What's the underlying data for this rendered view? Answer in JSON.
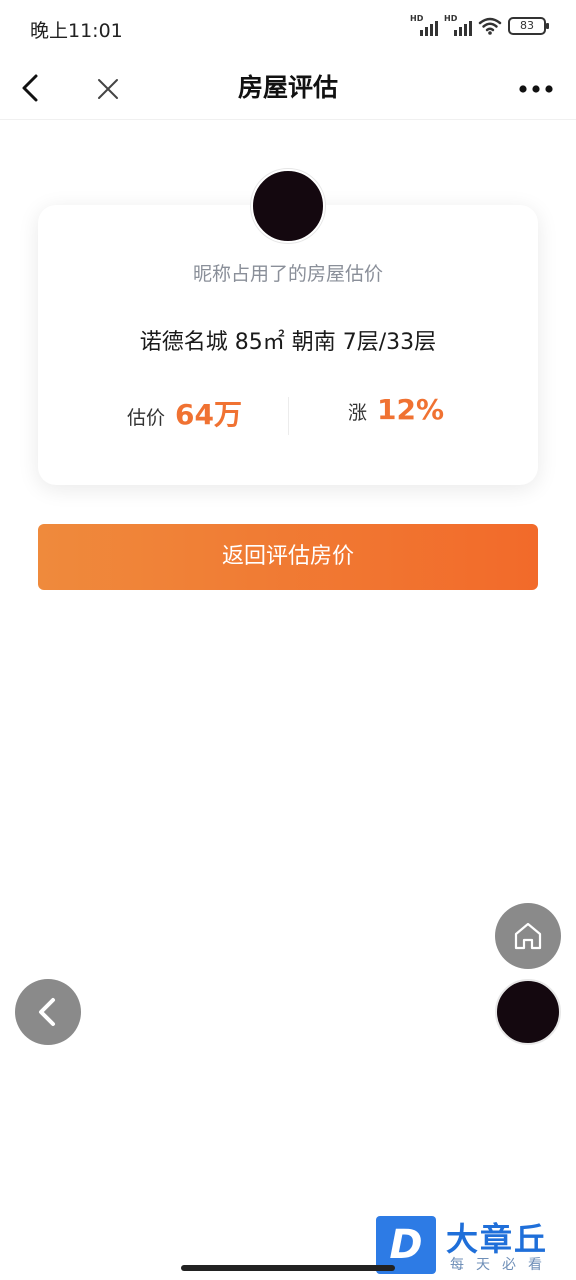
{
  "status_bar": {
    "time": "晚上11:01",
    "signal_1_label": "HD",
    "signal_2_label": "HD",
    "battery": "83"
  },
  "nav": {
    "title": "房屋评估",
    "back_icon": "chevron-left-icon",
    "close_icon": "close-icon",
    "more_icon": "more-horizontal-icon"
  },
  "card": {
    "subtitle": "昵称占用了的房屋估价",
    "house_info": "诺德名城 85㎡ 朝南 7层/33层",
    "price_label": "估价",
    "price_value": "64万",
    "rise_label": "涨",
    "rise_value": "12%"
  },
  "primary_button": {
    "label": "返回评估房价"
  },
  "floating": {
    "home_icon": "home-icon",
    "back_icon": "chevron-left-icon"
  },
  "watermark": {
    "logo_letter": "D",
    "name": "大章丘",
    "tagline": "每天必看"
  },
  "colors": {
    "accent": "#f07232",
    "button_start": "#ef8a3c",
    "button_end": "#f26a2a",
    "fab_gray": "#8a8a8a"
  }
}
